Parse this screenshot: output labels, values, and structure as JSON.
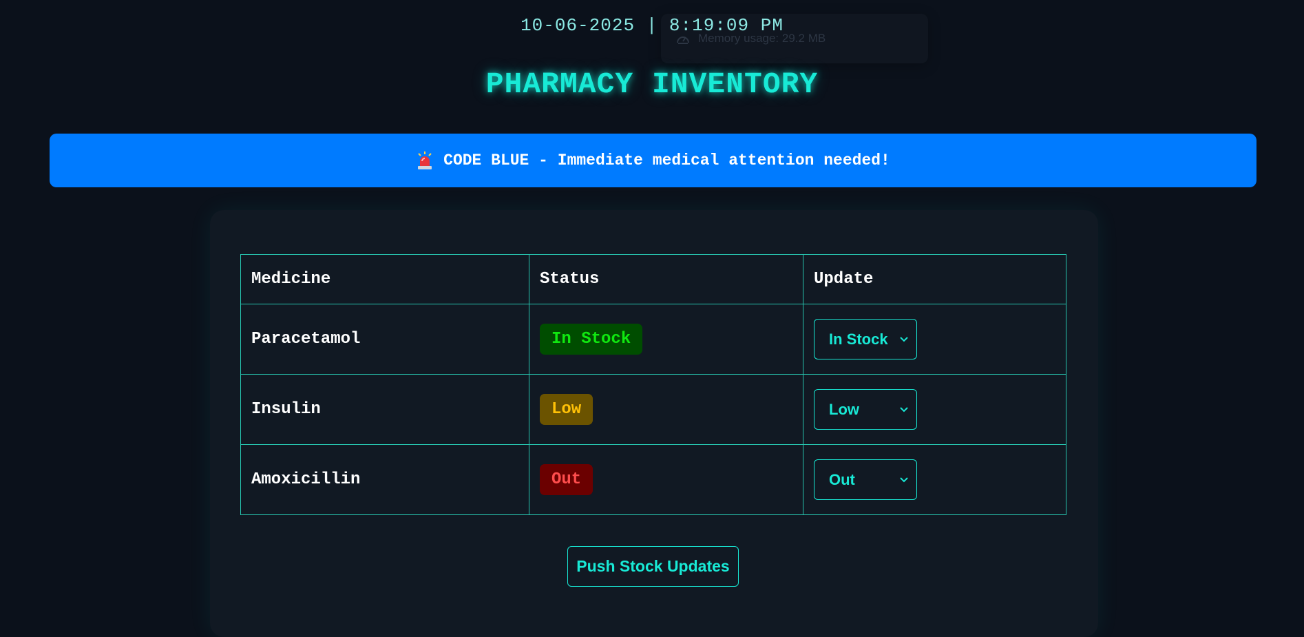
{
  "header": {
    "datetime": "10-06-2025 | 8:19:09 PM",
    "title": "PHARMACY INVENTORY"
  },
  "tooltip": {
    "icon": "gauge-icon",
    "text": "Memory usage: 29.2 MB"
  },
  "alert": {
    "icon": "siren-icon",
    "text": "CODE BLUE - Immediate medical attention needed!",
    "color": "#007bff"
  },
  "table": {
    "headers": [
      "Medicine",
      "Status",
      "Update"
    ],
    "rows": [
      {
        "medicine": "Paracetamol",
        "status": "In Stock",
        "update": "In Stock"
      },
      {
        "medicine": "Insulin",
        "status": "Low",
        "update": "Low"
      },
      {
        "medicine": "Amoxicillin",
        "status": "Out",
        "update": "Out"
      }
    ]
  },
  "status_colors": {
    "in_stock": "#10e810",
    "low": "#ffc107",
    "out": "#ff4d4d"
  },
  "actions": {
    "push_label": "Push Stock Updates"
  },
  "theme": {
    "accent": "#18ead6",
    "background": "#0b111b"
  }
}
